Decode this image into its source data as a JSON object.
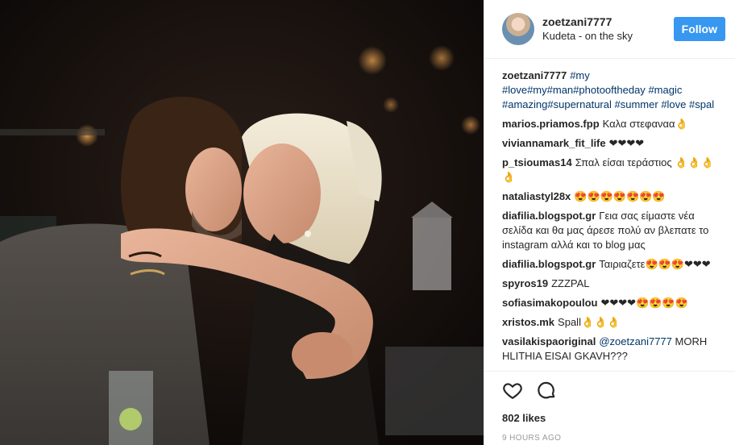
{
  "post": {
    "username": "zoetzani7777",
    "location": "Kudeta - on the sky",
    "follow_label": "Follow",
    "caption": {
      "user": "zoetzani7777",
      "hashtags": [
        "#my",
        "#love",
        "#my",
        "#man",
        "#photooftheday",
        "#magic",
        "#amazing",
        "#supernatural",
        "#summer",
        "#love",
        "#spal"
      ]
    },
    "comments": [
      {
        "user": "marios.priamos.fpp",
        "text": "Καλα στεφαναα👌"
      },
      {
        "user": "viviannamark_fit_life",
        "text": "❤❤❤❤"
      },
      {
        "user": "p_tsioumas14",
        "text": "Σπαλ είσαι τεράστιος 👌👌👌👌"
      },
      {
        "user": "nataliastyl28x",
        "text": "😍😍😍😍😍😍😍"
      },
      {
        "user": "diafilia.blogspot.gr",
        "text": "Γεια σας είμαστε νέα σελίδα και θα μας άρεσε πολύ αν βλεπατε το instagram αλλά και το blog μας"
      },
      {
        "user": "diafilia.blogspot.gr",
        "text": "Ταιριαζετε😍😍😍❤❤❤"
      },
      {
        "user": "spyros19",
        "text": "ZZZPAL"
      },
      {
        "user": "sofiasimakopoulou",
        "text": "❤❤❤❤😍😍😍😍"
      },
      {
        "user": "xristos.mk",
        "text": "Spall👌👌👌"
      },
      {
        "user": "vasilakispaoriginal",
        "mention": "@zoetzani7777",
        "text": "MORH HLITHIA EISAI GKAVH???"
      }
    ],
    "likes": "802 likes",
    "time": "9 HOURS AGO",
    "icons": {
      "like": "heart-outline-icon",
      "comment": "comment-bubble-icon"
    },
    "colors": {
      "follow": "#3897f0",
      "hashtag": "#003569",
      "border": "#efefef"
    }
  }
}
